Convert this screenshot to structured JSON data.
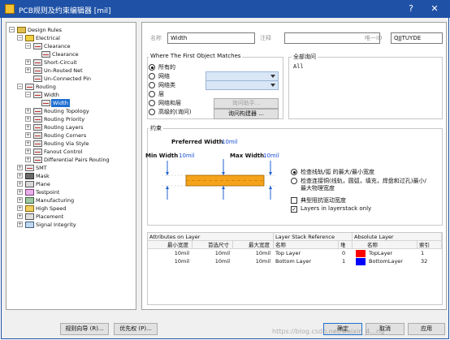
{
  "window": {
    "title": "PCB规则及约束编辑器 [mil]",
    "help": "?",
    "close": "✕"
  },
  "tree": {
    "root": "Design Rules",
    "electrical": "Electrical",
    "clearance_group": "Clearance",
    "clearance": "Clearance",
    "short_circuit": "Short-Circuit",
    "un_routed_net": "Un-Routed Net",
    "un_connected_pin": "Un-Connected Pin",
    "routing": "Routing",
    "width_group": "Width",
    "width": "Width",
    "routing_topology": "Routing Topology",
    "routing_priority": "Routing Priority",
    "routing_layers": "Routing Layers",
    "routing_corners": "Routing Corners",
    "routing_via_style": "Routing Via Style",
    "fanout_control": "Fanout Control",
    "differential_pairs": "Differential Pairs Routing",
    "smt": "SMT",
    "mask": "Mask",
    "plane": "Plane",
    "testpoint": "Testpoint",
    "manufacturing": "Manufacturing",
    "high_speed": "High Speed",
    "placement": "Placement",
    "signal_integrity": "Signal Integrity"
  },
  "rule": {
    "name_label": "名称",
    "name_value": "Width",
    "comment_label": "注释",
    "comment_value": "",
    "id_label": "唯一ID",
    "id_value": "QJJTUYDE"
  },
  "scope": {
    "where_label": "Where The First Object Matches",
    "options": [
      "所有的",
      "网络",
      "网络类",
      "层",
      "网络和层",
      "高级的(询问)"
    ],
    "query_helper": "询问助手...",
    "query_builder": "询问构建器 ...",
    "full_query_label": "全部询问",
    "full_query_value": "All"
  },
  "constraints": {
    "label": "约束",
    "preferred_label": "Preferred Width",
    "preferred_value": "10mil",
    "min_label": "Min Width",
    "min_value": "10mil",
    "max_label": "Max Width",
    "max_value": "10mil",
    "radio_check_min_max": "检查线轨/弧 的最大/最小宽度",
    "radio_check_conn_line1": "检查连接铜(线轨，圆弧，填充，焊盘和过孔)最小/",
    "radio_check_conn_line2": "最大物理宽度",
    "typical_impedance": "典型阻抗驱动宽度",
    "layers_in_stack": "Layers in layerstack only"
  },
  "table": {
    "attr_header": "Attributes on Layer",
    "stack_header": "Layer Stack Reference",
    "abs_header": "Absolute Layer",
    "col_min": "最小宽度",
    "col_pref": "首选尺寸",
    "col_max": "最大宽度",
    "col_name": "名称",
    "col_stack": "堆",
    "col_abs_name": "名称",
    "col_index": "索引",
    "rows": [
      {
        "min": "10mil",
        "pref": "10mil",
        "max": "10mil",
        "name": "Top Layer",
        "stack": "0",
        "color": "#ff0000",
        "abs_name": "TopLayer",
        "index": "1"
      },
      {
        "min": "10mil",
        "pref": "10mil",
        "max": "10mil",
        "name": "Bottom Layer",
        "stack": "1",
        "color": "#0000ff",
        "abs_name": "BottomLayer",
        "index": "32"
      }
    ]
  },
  "footer": {
    "wizard": "规则向导 (R)...",
    "priorities": "优先权 (P)...",
    "ok": "确定",
    "cancel": "取消",
    "apply": "应用"
  },
  "watermark": "https://blog.csdn.net/weixin_4...ng"
}
